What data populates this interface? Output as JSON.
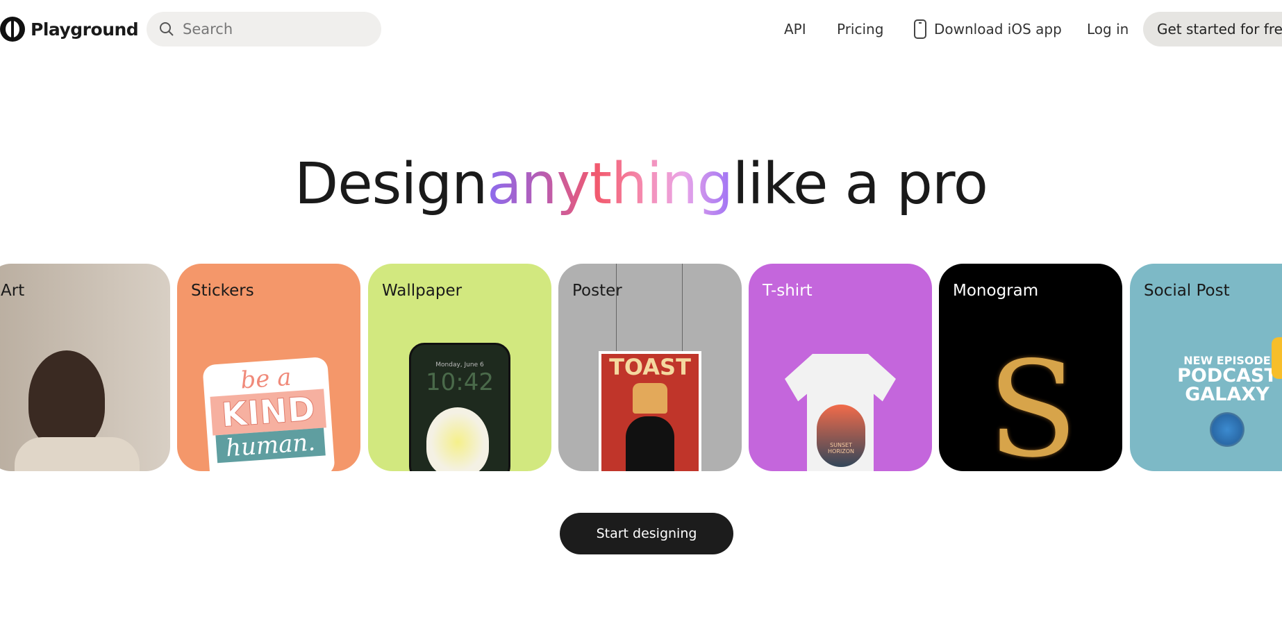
{
  "header": {
    "brand": "Playground",
    "search_placeholder": "Search",
    "nav": {
      "api": "API",
      "pricing": "Pricing",
      "download": "Download iOS app",
      "login": "Log in",
      "cta": "Get started for free"
    }
  },
  "hero": {
    "title_pre": "Design",
    "title_accent": "anything",
    "title_post": "like a pro"
  },
  "cards": [
    {
      "label": "Art",
      "color": "#c9bfb3"
    },
    {
      "label": "Stickers",
      "color": "#f4976a",
      "art_text": [
        "be a",
        "KIND",
        "human."
      ]
    },
    {
      "label": "Wallpaper",
      "color": "#d2e87f",
      "art_text": [
        "Monday, June 6",
        "10:42"
      ]
    },
    {
      "label": "Poster",
      "color": "#b0b0b0",
      "art_text": [
        "TOAST"
      ]
    },
    {
      "label": "T-shirt",
      "color": "#c466dc",
      "art_text": [
        "SUNSET HORIZON"
      ]
    },
    {
      "label": "Monogram",
      "color": "#000000",
      "art_text": [
        "S"
      ]
    },
    {
      "label": "Social Post",
      "color": "#7db9c6",
      "art_text": [
        "NEW EPISODE",
        "PODCAST",
        "GALAXY"
      ]
    }
  ],
  "start_button": "Start designing"
}
